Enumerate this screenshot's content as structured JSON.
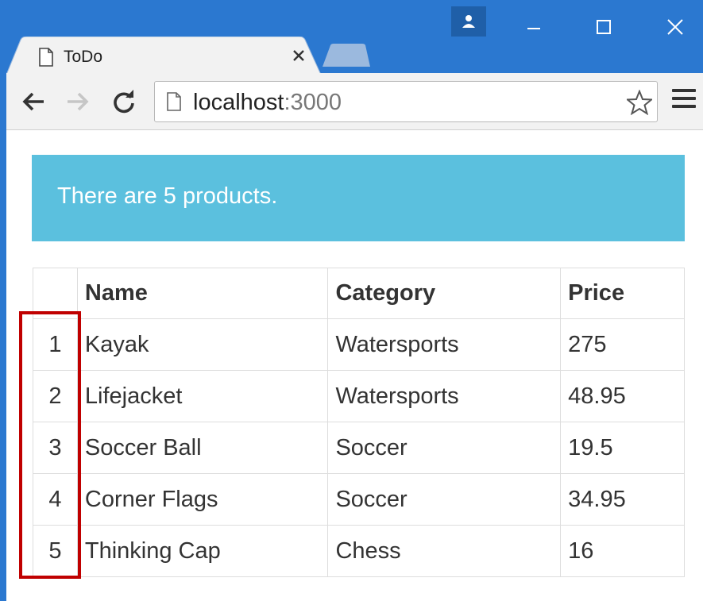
{
  "browser": {
    "tab_title": "ToDo",
    "url_host": "localhost",
    "url_port": ":3000"
  },
  "icons": {
    "profile": "person-icon",
    "minimize": "minimize-icon",
    "maximize": "maximize-icon",
    "close": "close-icon",
    "tab_page": "document-icon",
    "tab_close": "close-icon",
    "back": "back-arrow-icon",
    "forward": "forward-arrow-icon",
    "reload": "reload-icon",
    "page": "page-icon",
    "bookmark": "star-icon",
    "menu": "hamburger-menu-icon"
  },
  "colors": {
    "titlebar": "#2b78d0",
    "alert_bg": "#5bc0de",
    "highlight": "#c00000"
  },
  "alert": {
    "text": "There are 5 products."
  },
  "table": {
    "headers": [
      "",
      "Name",
      "Category",
      "Price"
    ],
    "rows": [
      [
        "1",
        "Kayak",
        "Watersports",
        "275"
      ],
      [
        "2",
        "Lifejacket",
        "Watersports",
        "48.95"
      ],
      [
        "3",
        "Soccer Ball",
        "Soccer",
        "19.5"
      ],
      [
        "4",
        "Corner Flags",
        "Soccer",
        "34.95"
      ],
      [
        "5",
        "Thinking Cap",
        "Chess",
        "16"
      ]
    ]
  }
}
